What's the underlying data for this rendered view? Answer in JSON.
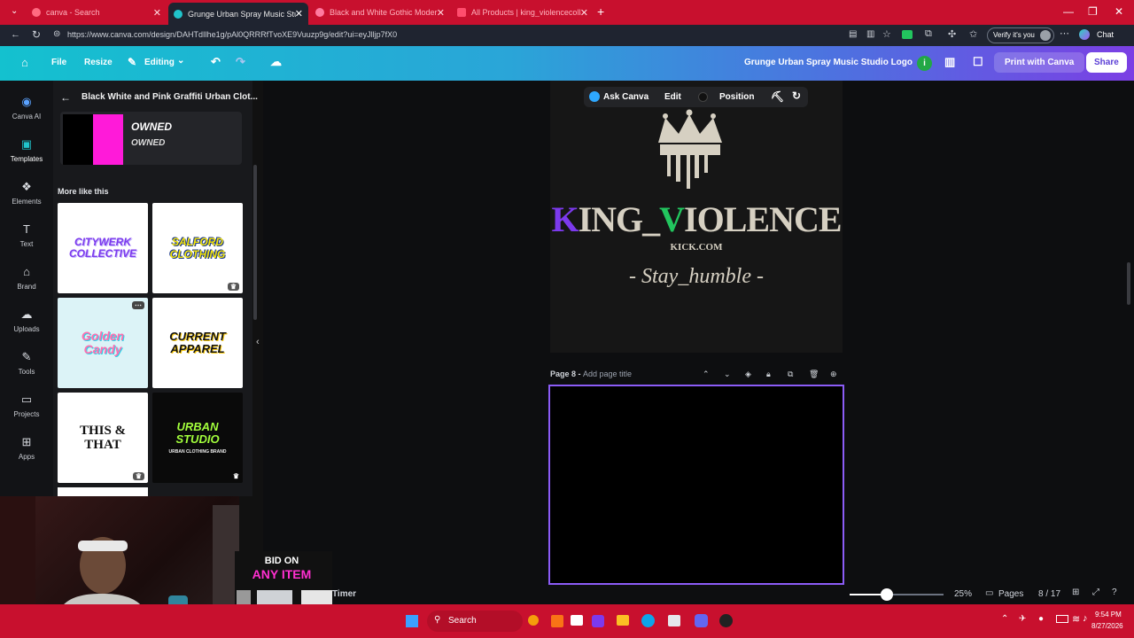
{
  "browser": {
    "tabs": [
      {
        "label": "canva - Search",
        "active": false
      },
      {
        "label": "Grunge Urban Spray Music Studio",
        "active": true
      },
      {
        "label": "Black and White Gothic Modern C",
        "active": false
      },
      {
        "label": "All Products | king_violencecollabs",
        "active": false
      }
    ],
    "new_tab": "+",
    "url": "https://www.canva.com/design/DAHTdIlhe1g/pAl0QRRRfTvoXE9Vuuzp9g/edit?ui=eyJlljp7fX0",
    "verify_label": "Verify it's you",
    "chat_label": "Chat"
  },
  "toolbar": {
    "file": "File",
    "resize": "Resize",
    "editing": "Editing",
    "design_title": "Grunge Urban Spray Music Studio Logo",
    "info_badge": "i",
    "print_label": "Print with Canva",
    "share_label": "Share"
  },
  "rail": [
    {
      "label": "Canva AI",
      "icon": "canva-ai-icon"
    },
    {
      "label": "Templates",
      "icon": "templates-icon"
    },
    {
      "label": "Elements",
      "icon": "elements-icon"
    },
    {
      "label": "Text",
      "icon": "text-icon"
    },
    {
      "label": "Brand",
      "icon": "brand-icon"
    },
    {
      "label": "Uploads",
      "icon": "uploads-icon"
    },
    {
      "label": "Tools",
      "icon": "tools-icon"
    },
    {
      "label": "Projects",
      "icon": "projects-icon"
    },
    {
      "label": "Apps",
      "icon": "apps-icon"
    }
  ],
  "panel": {
    "title": "Black White and Pink Graffiti Urban Clot...",
    "swatch_text_1": "OWNED",
    "swatch_text_2": "OWNED",
    "section": "More like this",
    "thumbs": [
      {
        "text": "CITYWERK COLLECTIVE"
      },
      {
        "text": "SALFORD CLOTHING"
      },
      {
        "text": "Golden Candy"
      },
      {
        "text": "CURRENT APPAREL"
      },
      {
        "text": "THIS & THAT"
      },
      {
        "text": "URBAN STUDIO"
      }
    ],
    "thumb_subtext": "URBAN CLOTHING BRAND"
  },
  "context_toolbar": {
    "ask": "Ask Canva",
    "edit": "Edit",
    "position": "Position"
  },
  "design": {
    "brand_k": "K",
    "brand_1": "ING_",
    "brand_v": "V",
    "brand_2": "IOLENCE",
    "domain": "KICK.COM",
    "tagline": "- Stay_humble -"
  },
  "page8": {
    "label": "Page 8 - ",
    "placeholder": "Add page title"
  },
  "bottom": {
    "timer": "Timer",
    "zoom": "25%",
    "pages_label": "Pages",
    "page_count": "8 / 17",
    "zoom_level": 0.4
  },
  "overlay": {
    "line1": "BID ON",
    "line2": "ANY ITEM"
  },
  "taskbar": {
    "search": "Search",
    "time": "9:54 PM",
    "date": "8/27/2026"
  },
  "colors": {
    "accent_purple": "#8b5cf6",
    "brand_green": "#22c55e",
    "brand_violet": "#7c3aed",
    "pink_swatch": "#ff1ad9"
  }
}
